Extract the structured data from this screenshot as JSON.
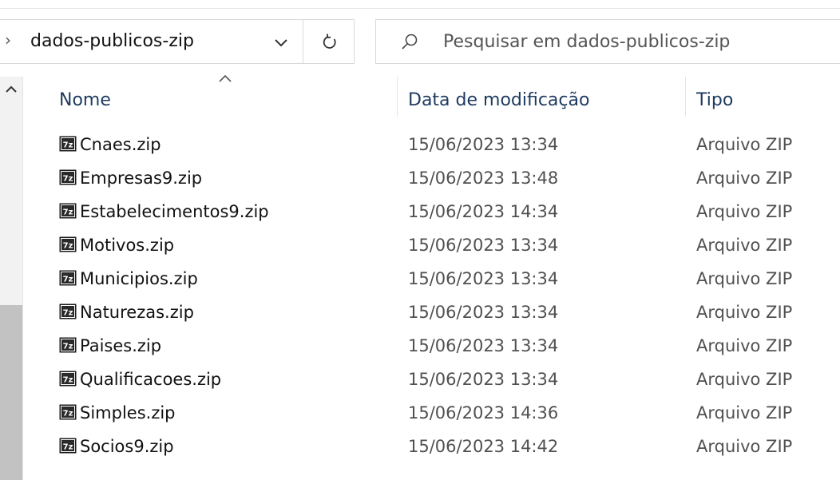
{
  "address": {
    "path": "dados-publicos-zip"
  },
  "search": {
    "placeholder": "Pesquisar em dados-publicos-zip"
  },
  "columns": {
    "name": "Nome",
    "date": "Data de modificação",
    "type": "Tipo"
  },
  "files": [
    {
      "name": "Cnaes.zip",
      "date": "15/06/2023 13:34",
      "type": "Arquivo ZIP"
    },
    {
      "name": "Empresas9.zip",
      "date": "15/06/2023 13:48",
      "type": "Arquivo ZIP"
    },
    {
      "name": "Estabelecimentos9.zip",
      "date": "15/06/2023 14:34",
      "type": "Arquivo ZIP"
    },
    {
      "name": "Motivos.zip",
      "date": "15/06/2023 13:34",
      "type": "Arquivo ZIP"
    },
    {
      "name": "Municipios.zip",
      "date": "15/06/2023 13:34",
      "type": "Arquivo ZIP"
    },
    {
      "name": "Naturezas.zip",
      "date": "15/06/2023 13:34",
      "type": "Arquivo ZIP"
    },
    {
      "name": "Paises.zip",
      "date": "15/06/2023 13:34",
      "type": "Arquivo ZIP"
    },
    {
      "name": "Qualificacoes.zip",
      "date": "15/06/2023 13:34",
      "type": "Arquivo ZIP"
    },
    {
      "name": "Simples.zip",
      "date": "15/06/2023 14:36",
      "type": "Arquivo ZIP"
    },
    {
      "name": "Socios9.zip",
      "date": "15/06/2023 14:42",
      "type": "Arquivo ZIP"
    }
  ],
  "icons": {
    "address_prefix": "chevron-right-icon",
    "address_dropdown": "chevron-down-icon",
    "refresh": "refresh-icon",
    "search": "search-icon",
    "sort": "sort-ascending-icon",
    "file": "7zip-archive-icon"
  },
  "colors": {
    "header_text": "#1e3a5f",
    "secondary_text": "#505050",
    "border": "#d9d9d9",
    "scroll_thumb": "#c2c2c2"
  }
}
